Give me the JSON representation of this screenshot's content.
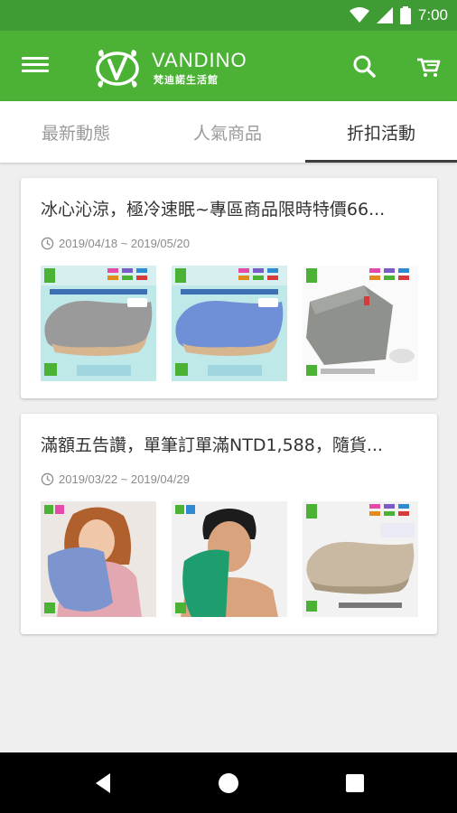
{
  "status_bar": {
    "time": "7:00",
    "icons": [
      "wifi-icon",
      "signal-icon",
      "battery-icon"
    ]
  },
  "app_bar": {
    "logo_name": "VANDINO",
    "logo_subtitle": "梵迪諾生活館",
    "icons": [
      "menu-icon",
      "search-icon",
      "cart-icon"
    ]
  },
  "tabs": [
    {
      "label": "最新動態",
      "active": false
    },
    {
      "label": "人氣商品",
      "active": false
    },
    {
      "label": "折扣活動",
      "active": true
    }
  ],
  "promotions": [
    {
      "title": "冰心沁涼，極冷速眠~專區商品限時特價66...",
      "date_range": "2019/04/18 ~ 2019/05/20",
      "images": [
        "gray-pillow-image",
        "blue-pillow-image",
        "gray-pillowcase-image"
      ]
    },
    {
      "title": "滿額五告讚，單筆訂單滿NTD1,588，隨貨...",
      "date_range": "2019/03/22 ~ 2019/04/29",
      "images": [
        "woman-towel-image",
        "man-towel-image",
        "beige-pillow-image"
      ]
    }
  ],
  "colors": {
    "status_bar": "#3f9b34",
    "app_bar": "#4cb236",
    "tab_active": "#333333",
    "tab_inactive": "#9a9a9a"
  }
}
